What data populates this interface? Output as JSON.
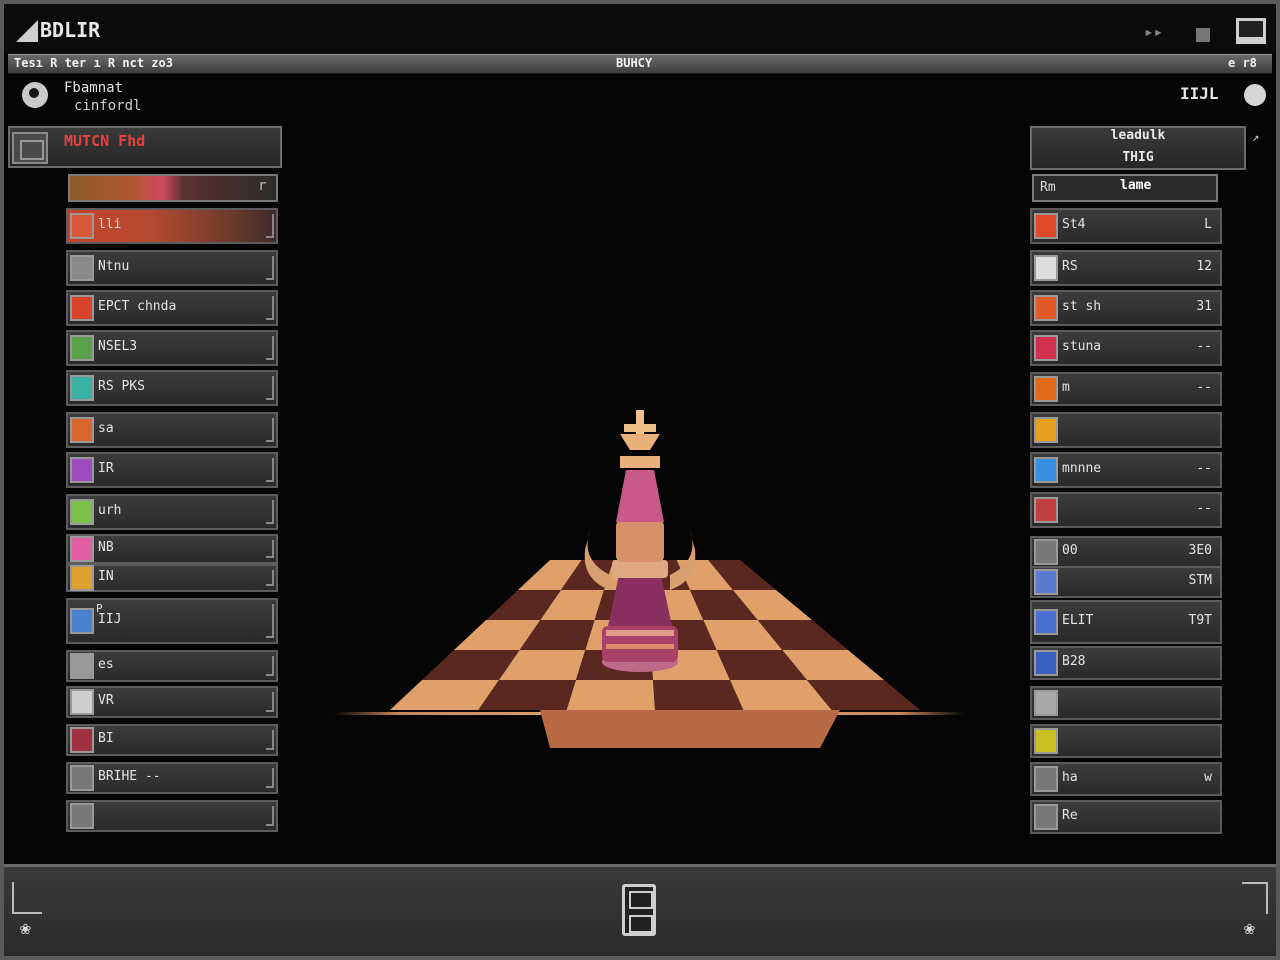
{
  "window": {
    "title": "BDLIR",
    "controls": [
      "minimize",
      "restore",
      "maximize"
    ]
  },
  "menu": {
    "left": "Tesı R ter ı R nct zo3",
    "center": "BUHCY",
    "right": "e r8"
  },
  "player": {
    "name": "Fbamnat",
    "subtitle": "cinfordl"
  },
  "opponent": {
    "label": "IIJL"
  },
  "left_panel": {
    "title": "MUTCN Fhd",
    "bar_end": "r",
    "items": [
      {
        "label": "lli",
        "color": "#d85a3a",
        "highlight": true
      },
      {
        "label": "Ntnu",
        "color": "#8a8a8a"
      },
      {
        "label": "EPCT chnda",
        "color": "#d8452a"
      },
      {
        "label": "NSEL3",
        "color": "#5aa04a"
      },
      {
        "label": "RS PKS",
        "color": "#3ab0a0"
      },
      {
        "label": "sa",
        "color": "#d8662a"
      },
      {
        "label": "IR",
        "color": "#a04ac0"
      },
      {
        "label": "urh",
        "color": "#7ac04a"
      },
      {
        "label": "NB",
        "color": "#e060a0"
      },
      {
        "label": "IN",
        "color": "#e0a030"
      },
      {
        "label": "P",
        "color": "#d04040"
      },
      {
        "label": "IIJ",
        "color": "#4a80d0"
      },
      {
        "label": "es",
        "color": "#9a9a9a"
      },
      {
        "label": "VR",
        "color": "#cfcfcf"
      },
      {
        "label": "BI",
        "color": "#a03040"
      },
      {
        "label": "BRIHE --",
        "color": "#777777"
      },
      {
        "label": "",
        "color": "#777777"
      }
    ]
  },
  "right_panel": {
    "title_line1": "leadulk",
    "title_line2": "THIG",
    "sub_a": "Rm",
    "sub_b": "lame",
    "items": [
      {
        "label": "St4",
        "value": "L",
        "color": "#e04a2a"
      },
      {
        "label": "RS",
        "value": "12",
        "color": "#dcdcdc"
      },
      {
        "label": "st sh",
        "value": "31",
        "color": "#e05a2a"
      },
      {
        "label": "stuna",
        "value": "--",
        "color": "#d03050"
      },
      {
        "label": "m",
        "value": "--",
        "color": "#e06a1a"
      },
      {
        "label": "",
        "value": "",
        "color": "#e8a020"
      },
      {
        "label": "mnnne",
        "value": "--",
        "color": "#3a90e0"
      },
      {
        "label": "",
        "value": "--",
        "color": "#c04040"
      },
      {
        "label": "00",
        "value": "3E0",
        "color": "#777777"
      },
      {
        "label": "",
        "value": "STM",
        "color": "#5a7ad0"
      },
      {
        "label": "ELIT",
        "value": "T9T",
        "color": "#4a70d0"
      },
      {
        "label": "B28",
        "value": "",
        "color": "#3a60c0"
      },
      {
        "label": "",
        "value": "",
        "color": "#aaaaaa"
      },
      {
        "label": "",
        "value": "",
        "color": "#c8c020"
      },
      {
        "label": "ha",
        "value": "w",
        "color": "#777777"
      },
      {
        "label": "Re",
        "value": "",
        "color": "#777777"
      }
    ]
  },
  "board": {
    "light": "#e0a06a",
    "dark": "#5a2820",
    "piece": "king"
  },
  "colors": {
    "accent_red": "#e84040",
    "panel": "#2a2a2a"
  }
}
